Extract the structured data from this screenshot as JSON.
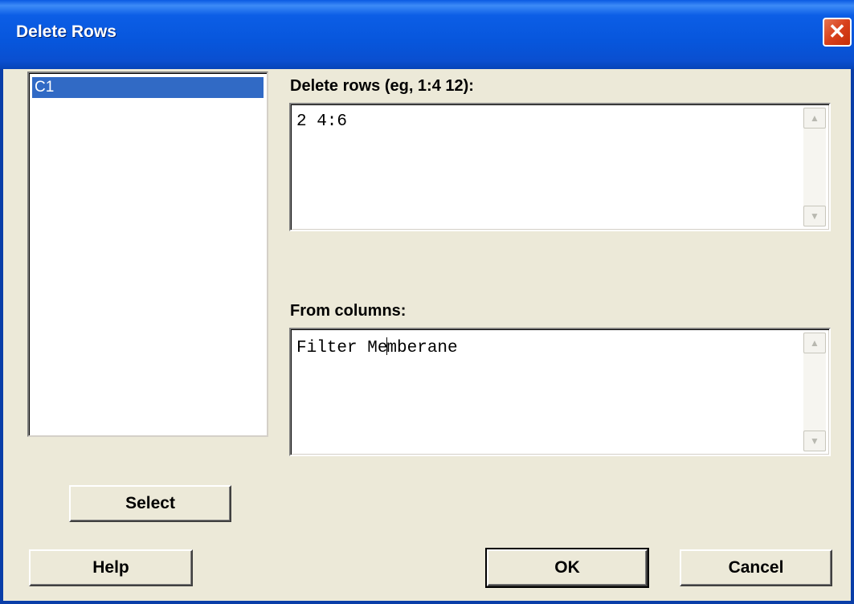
{
  "window": {
    "title": "Delete Rows",
    "close_symbol": "✕"
  },
  "column_list": {
    "items": [
      "C1"
    ],
    "selected": "C1"
  },
  "delete_rows": {
    "label": "Delete rows (eg,  1:4  12):",
    "value": "2 4:6"
  },
  "from_columns": {
    "label": "From columns:",
    "value_before_cursor": "Filter Me",
    "value_after_cursor": "mberane"
  },
  "buttons": {
    "select": "Select",
    "help": "Help",
    "ok": "OK",
    "cancel": "Cancel"
  },
  "icons": {
    "scroll_up": "chevron-up-icon",
    "scroll_down": "chevron-down-icon"
  },
  "colors": {
    "titlebar": "#0a5ae3",
    "selection": "#316ac5",
    "dialog_bg": "#ece9d8",
    "close_button": "#d8401c"
  }
}
